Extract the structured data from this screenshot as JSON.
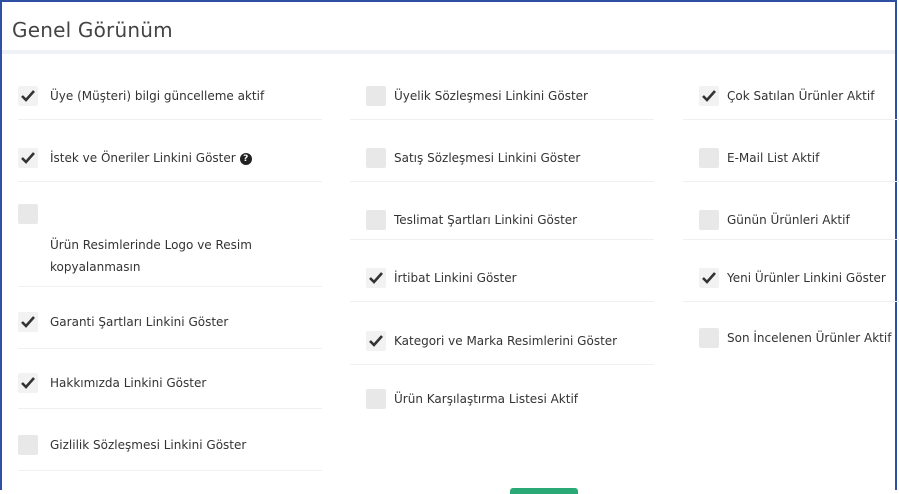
{
  "panel": {
    "title": "Genel Görünüm"
  },
  "columns": [
    {
      "options": [
        {
          "label": "Üye (Müşteri) bilgi güncelleme aktif",
          "checked": true
        },
        {
          "label": "İstek ve Öneriler Linkini Göster",
          "checked": true,
          "help": "?"
        },
        {
          "label": "Ürün Resimlerinde Logo ve Resim kopyalanmasın",
          "checked": false
        },
        {
          "label": "Garanti Şartları Linkini Göster",
          "checked": true
        },
        {
          "label": "Hakkımızda Linkini Göster",
          "checked": true
        },
        {
          "label": "Gizlilik Sözleşmesi Linkini Göster",
          "checked": false
        }
      ]
    },
    {
      "options": [
        {
          "label": "Üyelik Sözleşmesi Linkini Göster",
          "checked": false
        },
        {
          "label": "Satış Sözleşmesi Linkini Göster",
          "checked": false
        },
        {
          "label": "Teslimat Şartları Linkini Göster",
          "checked": false
        },
        {
          "label": "İrtibat Linkini Göster",
          "checked": true
        },
        {
          "label": "Kategori ve Marka Resimlerini Göster",
          "checked": true
        },
        {
          "label": "Ürün Karşılaştırma Listesi Aktif",
          "checked": false
        }
      ]
    },
    {
      "options": [
        {
          "label": "Çok Satılan Ürünler Aktif",
          "checked": true
        },
        {
          "label": "E-Mail List Aktif",
          "checked": false
        },
        {
          "label": "Günün Ürünleri Aktif",
          "checked": false
        },
        {
          "label": "Yeni Ürünler Linkini Göster",
          "checked": true
        },
        {
          "label": "Son İncelenen Ürünler Aktif",
          "checked": false
        }
      ]
    }
  ],
  "colors": {
    "border": "#2f4fa2",
    "checkbox_bg": "#e8e8e8",
    "checkmark": "#333333",
    "save_button": "#2aa876"
  }
}
